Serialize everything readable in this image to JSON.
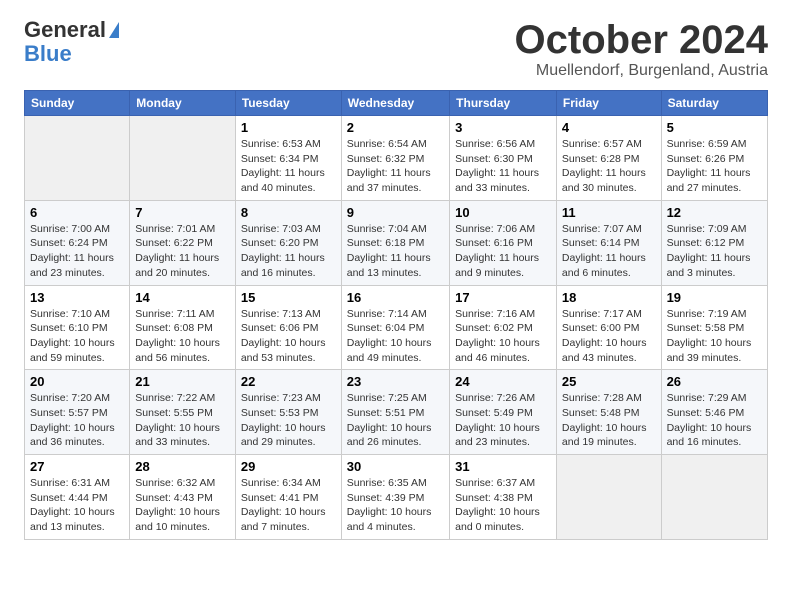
{
  "header": {
    "logo_general": "General",
    "logo_blue": "Blue",
    "month_title": "October 2024",
    "location": "Muellendorf, Burgenland, Austria"
  },
  "days_of_week": [
    "Sunday",
    "Monday",
    "Tuesday",
    "Wednesday",
    "Thursday",
    "Friday",
    "Saturday"
  ],
  "weeks": [
    [
      {
        "day": "",
        "info": ""
      },
      {
        "day": "",
        "info": ""
      },
      {
        "day": "1",
        "info": "Sunrise: 6:53 AM\nSunset: 6:34 PM\nDaylight: 11 hours and 40 minutes."
      },
      {
        "day": "2",
        "info": "Sunrise: 6:54 AM\nSunset: 6:32 PM\nDaylight: 11 hours and 37 minutes."
      },
      {
        "day": "3",
        "info": "Sunrise: 6:56 AM\nSunset: 6:30 PM\nDaylight: 11 hours and 33 minutes."
      },
      {
        "day": "4",
        "info": "Sunrise: 6:57 AM\nSunset: 6:28 PM\nDaylight: 11 hours and 30 minutes."
      },
      {
        "day": "5",
        "info": "Sunrise: 6:59 AM\nSunset: 6:26 PM\nDaylight: 11 hours and 27 minutes."
      }
    ],
    [
      {
        "day": "6",
        "info": "Sunrise: 7:00 AM\nSunset: 6:24 PM\nDaylight: 11 hours and 23 minutes."
      },
      {
        "day": "7",
        "info": "Sunrise: 7:01 AM\nSunset: 6:22 PM\nDaylight: 11 hours and 20 minutes."
      },
      {
        "day": "8",
        "info": "Sunrise: 7:03 AM\nSunset: 6:20 PM\nDaylight: 11 hours and 16 minutes."
      },
      {
        "day": "9",
        "info": "Sunrise: 7:04 AM\nSunset: 6:18 PM\nDaylight: 11 hours and 13 minutes."
      },
      {
        "day": "10",
        "info": "Sunrise: 7:06 AM\nSunset: 6:16 PM\nDaylight: 11 hours and 9 minutes."
      },
      {
        "day": "11",
        "info": "Sunrise: 7:07 AM\nSunset: 6:14 PM\nDaylight: 11 hours and 6 minutes."
      },
      {
        "day": "12",
        "info": "Sunrise: 7:09 AM\nSunset: 6:12 PM\nDaylight: 11 hours and 3 minutes."
      }
    ],
    [
      {
        "day": "13",
        "info": "Sunrise: 7:10 AM\nSunset: 6:10 PM\nDaylight: 10 hours and 59 minutes."
      },
      {
        "day": "14",
        "info": "Sunrise: 7:11 AM\nSunset: 6:08 PM\nDaylight: 10 hours and 56 minutes."
      },
      {
        "day": "15",
        "info": "Sunrise: 7:13 AM\nSunset: 6:06 PM\nDaylight: 10 hours and 53 minutes."
      },
      {
        "day": "16",
        "info": "Sunrise: 7:14 AM\nSunset: 6:04 PM\nDaylight: 10 hours and 49 minutes."
      },
      {
        "day": "17",
        "info": "Sunrise: 7:16 AM\nSunset: 6:02 PM\nDaylight: 10 hours and 46 minutes."
      },
      {
        "day": "18",
        "info": "Sunrise: 7:17 AM\nSunset: 6:00 PM\nDaylight: 10 hours and 43 minutes."
      },
      {
        "day": "19",
        "info": "Sunrise: 7:19 AM\nSunset: 5:58 PM\nDaylight: 10 hours and 39 minutes."
      }
    ],
    [
      {
        "day": "20",
        "info": "Sunrise: 7:20 AM\nSunset: 5:57 PM\nDaylight: 10 hours and 36 minutes."
      },
      {
        "day": "21",
        "info": "Sunrise: 7:22 AM\nSunset: 5:55 PM\nDaylight: 10 hours and 33 minutes."
      },
      {
        "day": "22",
        "info": "Sunrise: 7:23 AM\nSunset: 5:53 PM\nDaylight: 10 hours and 29 minutes."
      },
      {
        "day": "23",
        "info": "Sunrise: 7:25 AM\nSunset: 5:51 PM\nDaylight: 10 hours and 26 minutes."
      },
      {
        "day": "24",
        "info": "Sunrise: 7:26 AM\nSunset: 5:49 PM\nDaylight: 10 hours and 23 minutes."
      },
      {
        "day": "25",
        "info": "Sunrise: 7:28 AM\nSunset: 5:48 PM\nDaylight: 10 hours and 19 minutes."
      },
      {
        "day": "26",
        "info": "Sunrise: 7:29 AM\nSunset: 5:46 PM\nDaylight: 10 hours and 16 minutes."
      }
    ],
    [
      {
        "day": "27",
        "info": "Sunrise: 6:31 AM\nSunset: 4:44 PM\nDaylight: 10 hours and 13 minutes."
      },
      {
        "day": "28",
        "info": "Sunrise: 6:32 AM\nSunset: 4:43 PM\nDaylight: 10 hours and 10 minutes."
      },
      {
        "day": "29",
        "info": "Sunrise: 6:34 AM\nSunset: 4:41 PM\nDaylight: 10 hours and 7 minutes."
      },
      {
        "day": "30",
        "info": "Sunrise: 6:35 AM\nSunset: 4:39 PM\nDaylight: 10 hours and 4 minutes."
      },
      {
        "day": "31",
        "info": "Sunrise: 6:37 AM\nSunset: 4:38 PM\nDaylight: 10 hours and 0 minutes."
      },
      {
        "day": "",
        "info": ""
      },
      {
        "day": "",
        "info": ""
      }
    ]
  ]
}
